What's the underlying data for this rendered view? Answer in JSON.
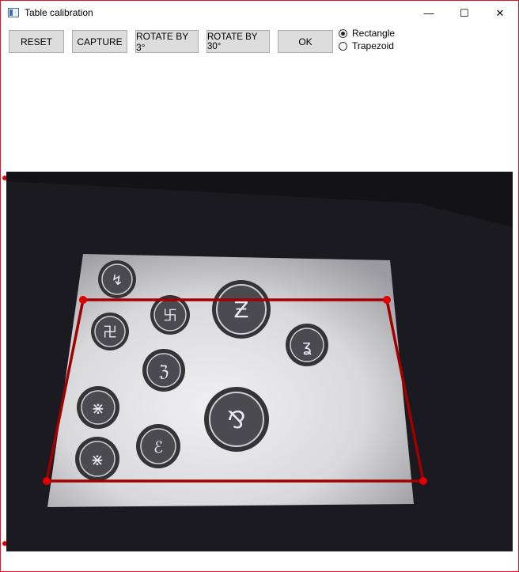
{
  "window": {
    "title": "Table calibration",
    "controls": {
      "minimize": "—",
      "maximize": "☐",
      "close": "✕"
    }
  },
  "toolbar": {
    "reset_label": "RESET",
    "capture_label": "CAPTURE",
    "rotate3_label": "ROTATE BY 3°",
    "rotate30_label": "ROTATE BY 30°",
    "ok_label": "OK"
  },
  "shape_options": [
    {
      "label": "Rectangle",
      "selected": true
    },
    {
      "label": "Trapezoid",
      "selected": false
    }
  ],
  "colors": {
    "window_border": "#e81123",
    "calibration_line": "#a00000",
    "handle": "#e00000",
    "camera_background": "#121116"
  }
}
